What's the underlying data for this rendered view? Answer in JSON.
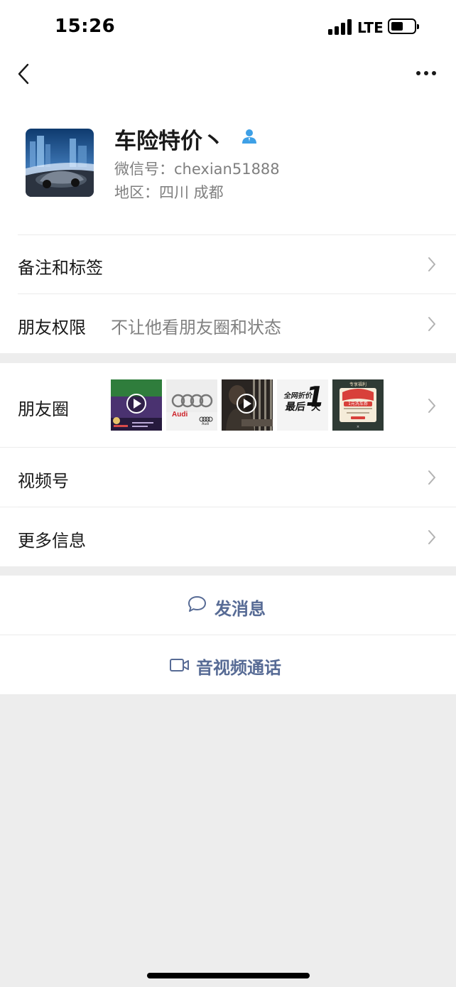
{
  "status": {
    "time": "15:26",
    "network": "LTE"
  },
  "profile": {
    "nickname": "车险特价丶",
    "wechat_id": "微信号：chexian51888",
    "region": "地区：四川 成都"
  },
  "rows": {
    "remarks": {
      "label": "备注和标签"
    },
    "permissions": {
      "label": "朋友权限",
      "value": "不让他看朋友圈和状态"
    },
    "moments": {
      "label": "朋友圈"
    },
    "channels": {
      "label": "视频号"
    },
    "more_info": {
      "label": "更多信息"
    }
  },
  "moments_thumbs": {
    "audi_text": "Audi",
    "audi_small": "Audi",
    "last_day_line1": "全网折价",
    "last_day_line2": "最后",
    "last_day_one": "1",
    "last_day_day": "天",
    "car_wash_top": "专享福利",
    "car_wash_badge": "1元洗车券"
  },
  "actions": {
    "message": "发消息",
    "call": "音视频通话"
  },
  "colors": {
    "link": "#576b95",
    "verify_icon": "#3ea0e6",
    "background": "#ededed"
  }
}
